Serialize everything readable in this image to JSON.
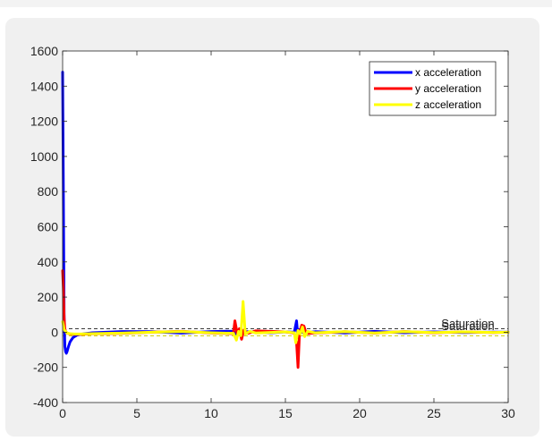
{
  "chart_data": {
    "type": "line",
    "title": "",
    "xlabel": "",
    "ylabel": "",
    "xlim": [
      0,
      30
    ],
    "ylim": [
      -400,
      1600
    ],
    "xticks": [
      0,
      5,
      10,
      15,
      20,
      25,
      30
    ],
    "yticks": [
      -400,
      -200,
      0,
      200,
      400,
      600,
      800,
      1000,
      1200,
      1400,
      1600
    ],
    "x_tick_labels": [
      "0",
      "5",
      "10",
      "15",
      "20",
      "25",
      "30"
    ],
    "y_tick_labels": [
      "-400",
      "-200",
      "0",
      "200",
      "400",
      "600",
      "800",
      "1000",
      "1200",
      "1400",
      "1600"
    ],
    "grid": false,
    "legend_position": "top-right",
    "series": [
      {
        "name": "x acceleration",
        "color": "#0000ff",
        "x": [
          0,
          0.05,
          0.1,
          0.15,
          0.2,
          0.25,
          0.3,
          0.4,
          0.5,
          0.7,
          1.0,
          1.5,
          2,
          4,
          6,
          8,
          10,
          11.5,
          11.7,
          11.9,
          12.1,
          12.3,
          13,
          14,
          15,
          15.6,
          15.75,
          15.85,
          15.95,
          16.2,
          17,
          19,
          21,
          23,
          25,
          27,
          29,
          30
        ],
        "y": [
          1480,
          800,
          100,
          -80,
          -110,
          -120,
          -110,
          -80,
          -55,
          -30,
          -15,
          -8,
          -3,
          4,
          3,
          -5,
          4,
          6,
          -10,
          10,
          -6,
          3,
          2,
          -3,
          2,
          0,
          65,
          -30,
          15,
          -4,
          3,
          -4,
          5,
          -3,
          2,
          -2,
          1,
          0
        ]
      },
      {
        "name": "y acceleration",
        "color": "#ff0000",
        "x": [
          0,
          0.05,
          0.1,
          0.15,
          0.2,
          0.3,
          0.5,
          0.8,
          1.2,
          2,
          4,
          6,
          8,
          10,
          11.5,
          11.6,
          11.75,
          11.9,
          12.05,
          12.2,
          12.5,
          13,
          15,
          15.6,
          15.75,
          15.85,
          15.95,
          16.1,
          16.25,
          16.4,
          17,
          19,
          21,
          23,
          25,
          27,
          29,
          30
        ],
        "y": [
          350,
          250,
          80,
          20,
          5,
          -5,
          -10,
          -12,
          -12,
          -9,
          -6,
          0,
          5,
          -4,
          -8,
          65,
          -5,
          20,
          -40,
          12,
          -6,
          8,
          2,
          -5,
          -55,
          -200,
          -5,
          40,
          35,
          -8,
          -4,
          3,
          -5,
          4,
          -3,
          2,
          -2,
          0
        ]
      },
      {
        "name": "z acceleration",
        "color": "#ffff00",
        "x": [
          0,
          0.05,
          0.1,
          0.2,
          0.3,
          0.5,
          0.8,
          1.2,
          2,
          4,
          6,
          8,
          10,
          11.5,
          11.7,
          11.85,
          12.0,
          12.15,
          12.3,
          12.6,
          13,
          15,
          15.6,
          15.7,
          15.85,
          16.0,
          16.15,
          16.3,
          16.5,
          17,
          19,
          21,
          23,
          25,
          27,
          29,
          30
        ],
        "y": [
          60,
          40,
          15,
          5,
          -5,
          -8,
          -10,
          -10,
          -8,
          -5,
          0,
          4,
          -3,
          -6,
          -45,
          5,
          -20,
          175,
          -10,
          5,
          -4,
          2,
          -3,
          -60,
          10,
          -10,
          30,
          -25,
          5,
          -3,
          3,
          -4,
          3,
          -2,
          2,
          -1,
          0
        ]
      }
    ],
    "reference_lines": [
      {
        "y": 20,
        "style": "dashed",
        "color": "#3a3a3a"
      },
      {
        "y": -20,
        "style": "dashed",
        "color": "#cccc00"
      }
    ],
    "annotations": [
      {
        "text": "Saturation",
        "x": 25.5,
        "y": 28
      },
      {
        "text": "Saturation",
        "x": 25.5,
        "y": 12
      }
    ]
  }
}
